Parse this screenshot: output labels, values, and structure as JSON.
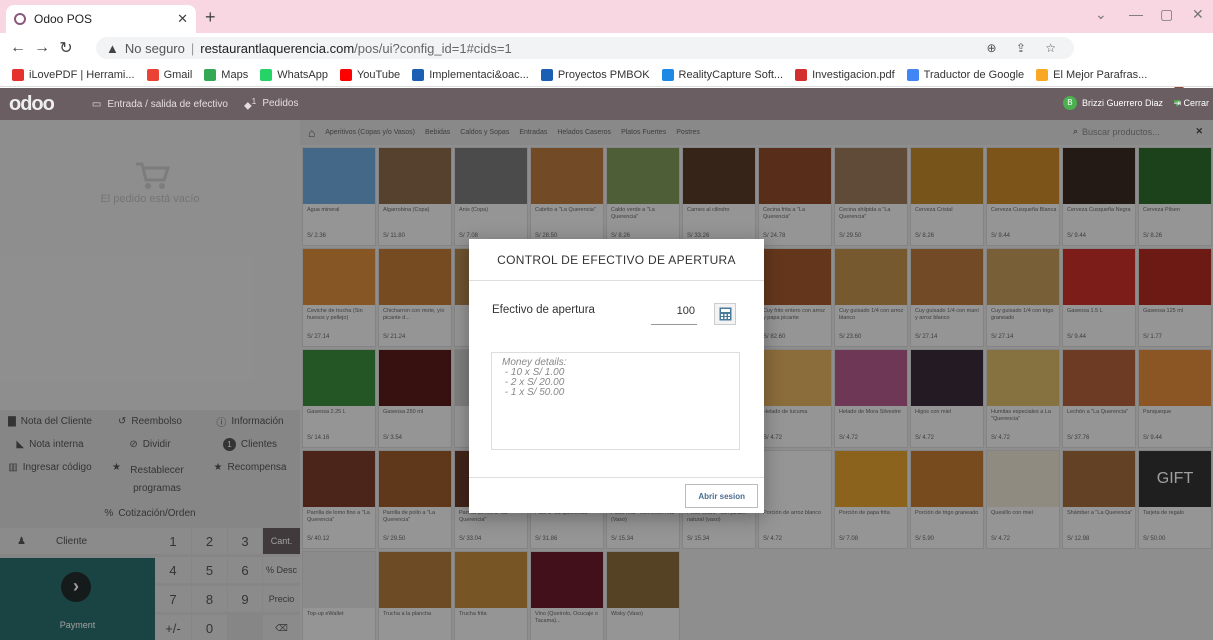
{
  "browser": {
    "tab_title": "Odoo POS",
    "address_warning": "No seguro",
    "url_host": "restaurantlaquerencia.com",
    "url_path": "/pos/ui?config_id=1#cids=1",
    "bookmarks": [
      {
        "label": "iLovePDF | Herrami...",
        "color": "#e5322d"
      },
      {
        "label": "Gmail",
        "color": "#ea4335"
      },
      {
        "label": "Maps",
        "color": "#34a853"
      },
      {
        "label": "WhatsApp",
        "color": "#25d366"
      },
      {
        "label": "YouTube",
        "color": "#ff0000"
      },
      {
        "label": "Implementaci&oac...",
        "color": "#1a5fb4"
      },
      {
        "label": "Proyectos PMBOK",
        "color": "#1a5fb4"
      },
      {
        "label": "RealityCapture Soft...",
        "color": "#1e88e5"
      },
      {
        "label": "Investigacion.pdf",
        "color": "#d32f2f"
      },
      {
        "label": "Traductor de Google",
        "color": "#4285f4"
      },
      {
        "label": "El Mejor Parafras...",
        "color": "#f9a825"
      }
    ]
  },
  "header": {
    "logo": "odoo",
    "cash_in_out": "Entrada / salida de efectivo",
    "orders_badge": "1",
    "orders": "Pedidos",
    "user_initial": "B",
    "user_name": "Brizzi Guerrero Diaz",
    "close": "Cerrar"
  },
  "left": {
    "empty_order": "El pedido está vacío",
    "controls_row1": [
      "Nota del Cliente",
      "Reembolso",
      "Información"
    ],
    "controls_row2": [
      "Nota interna",
      "Dividir",
      "Clientes"
    ],
    "clients_badge": "1",
    "controls_row3": [
      "Ingresar código",
      "Restablecer programas",
      "Recompensa"
    ],
    "quotation": "Cotización/Orden",
    "customer": "Cliente",
    "keys": [
      "1",
      "2",
      "3",
      "Cant.",
      "4",
      "5",
      "6",
      "% Desc",
      "7",
      "8",
      "9",
      "Precio",
      "+/-",
      "0",
      "⌫"
    ],
    "payment": "Payment"
  },
  "categories": {
    "items": [
      "Aperitivos (Copas y/o Vasos)",
      "Bebidas",
      "Caldos y Sopas",
      "Entradas",
      "Helados Caseros",
      "Platos Fuertes",
      "Postres"
    ],
    "search_placeholder": "Buscar productos..."
  },
  "products": [
    {
      "name": "Agua mineral",
      "price": "S/ 2.36",
      "color": "#6fa8dc"
    },
    {
      "name": "Algarrobina (Copa)",
      "price": "S/ 11.80",
      "color": "#8a6a4a"
    },
    {
      "name": "Anis (Copa)",
      "price": "S/ 7.08",
      "color": "#7a7a7a"
    },
    {
      "name": "Cabrito a \"La Querencia\"",
      "price": "S/ 28.50",
      "color": "#b8793e"
    },
    {
      "name": "Caldo verde a \"La Querencia\"",
      "price": "S/ 8.26",
      "color": "#7e9a5a"
    },
    {
      "name": "Carnes al cilindro",
      "price": "S/ 33.26",
      "color": "#5a3a28"
    },
    {
      "name": "Cecina frita a \"La Querencia\"",
      "price": "S/ 24.78",
      "color": "#8e4a2a"
    },
    {
      "name": "Cecina shilpida a \"La Querencia\"",
      "price": "S/ 29.50",
      "color": "#9a7a5a"
    },
    {
      "name": "Cerveza Cristal",
      "price": "S/ 8.26",
      "color": "#c08a2a"
    },
    {
      "name": "Cerveza Cusqueña Blanca",
      "price": "S/ 9.44",
      "color": "#c9882a"
    },
    {
      "name": "Cerveza Cusqueña Negra",
      "price": "S/ 9.44",
      "color": "#3a2a22"
    },
    {
      "name": "Cerveza Pilsen",
      "price": "S/ 8.26",
      "color": "#2e6b2e"
    },
    {
      "name": "Ceviche de trucha (Sin huesos y pellejo)",
      "price": "S/ 27.14",
      "color": "#d98b3a"
    },
    {
      "name": "Chicharron con mote, y/o picante d...",
      "price": "S/ 21.24",
      "color": "#c07a38"
    },
    {
      "name": "",
      "price": "",
      "color": "#b0864e"
    },
    {
      "name": "",
      "price": "",
      "color": "#9c6b3a"
    },
    {
      "name": "",
      "price": "",
      "color": "#a07a4e"
    },
    {
      "name": "",
      "price": "",
      "color": "#8a5a3a"
    },
    {
      "name": "Cuy frito entero con arroz y papa picante",
      "price": "S/ 82.60",
      "color": "#a25a2e"
    },
    {
      "name": "Cuy guisado 1/4 con arroz blanco",
      "price": "S/ 23.60",
      "color": "#c0904e"
    },
    {
      "name": "Cuy guisado 1/4 con maní y arroz blanco",
      "price": "S/ 27.14",
      "color": "#b87a3e"
    },
    {
      "name": "Cuy guisado 1/4 con trigo graneado",
      "price": "S/ 27.14",
      "color": "#c49a5a"
    },
    {
      "name": "Gaseosa 1.5 L",
      "price": "S/ 9.44",
      "color": "#c8302a"
    },
    {
      "name": "Gaseosa 125 ml",
      "price": "S/ 1.77",
      "color": "#b02a22"
    },
    {
      "name": "Gaseosa 2.25 L",
      "price": "S/ 14.16",
      "color": "#3a8a3a"
    },
    {
      "name": "Gaseosa 250 ml",
      "price": "S/ 3.54",
      "color": "#5a1a1a"
    },
    {
      "name": "",
      "price": "",
      "color": "#cccccc"
    },
    {
      "name": "",
      "price": "",
      "color": "#cccccc"
    },
    {
      "name": "",
      "price": "",
      "color": "#cccccc"
    },
    {
      "name": "",
      "price": "",
      "color": "#cccccc"
    },
    {
      "name": "Helado de lucuma",
      "price": "S/ 4.72",
      "color": "#e0b060"
    },
    {
      "name": "Helado de Mora Silvestre",
      "price": "S/ 4.72",
      "color": "#b05a8a"
    },
    {
      "name": "Higos con miel",
      "price": "S/ 4.72",
      "color": "#3a2a3a"
    },
    {
      "name": "Humitas especiales a La \"Querencia\"",
      "price": "S/ 4.72",
      "color": "#d8b86a"
    },
    {
      "name": "Lechón a \"La Querencia\"",
      "price": "S/ 37.76",
      "color": "#b0603a"
    },
    {
      "name": "Panqueque",
      "price": "S/ 9.44",
      "color": "#e08a3a"
    },
    {
      "name": "Parrilla de lomo fino a \"La Querencia\"",
      "price": "S/ 40.12",
      "color": "#7a3a2a"
    },
    {
      "name": "Parrilla de pollo a \"La Querencia\"",
      "price": "S/ 29.50",
      "color": "#9a5a2a"
    },
    {
      "name": "Parrilla de res a \"La Querencia\"",
      "price": "S/ 33.04",
      "color": "#6a3a2a"
    },
    {
      "name": "Pato a \"La Querencia\"",
      "price": "S/ 31.86",
      "color": "#a0602a"
    },
    {
      "name": "Pisco real - con limon real (Vaso)",
      "price": "S/ 15.34",
      "color": "#d8d0b8"
    },
    {
      "name": "Pisco sours - con jarabe natural (vaso)",
      "price": "S/ 15.34",
      "color": "#e8e0c8"
    },
    {
      "name": "Porción de arroz blanco",
      "price": "S/ 4.72",
      "color": "#f0f0f0"
    },
    {
      "name": "Porción de papa frita",
      "price": "S/ 7.08",
      "color": "#e0a030"
    },
    {
      "name": "Porción de trigo graneado",
      "price": "S/ 5.90",
      "color": "#c07a30"
    },
    {
      "name": "Quesillo con miel",
      "price": "S/ 4.72",
      "color": "#e8e0d0"
    },
    {
      "name": "Shámber a \"La Querencia\"",
      "price": "S/ 12.98",
      "color": "#a06a3a"
    },
    {
      "name": "Tarjeta de regalo",
      "price": "S/ 50.00",
      "color": "#333333",
      "label": "GIFT"
    },
    {
      "name": "Top-up eWallet",
      "price": "",
      "color": "#e0e0e0"
    },
    {
      "name": "Trucha a la plancha",
      "price": "",
      "color": "#b07a3a"
    },
    {
      "name": "Trucha frita",
      "price": "",
      "color": "#c08a3a"
    },
    {
      "name": "Vino (Queirolo, Ocucaje o Tacama)...",
      "price": "",
      "color": "#6a1a2a"
    },
    {
      "name": "Wisky (Vaso)",
      "price": "",
      "color": "#8a6a3a"
    }
  ],
  "modal": {
    "title": "CONTROL DE EFECTIVO DE APERTURA",
    "label": "Efectivo de apertura",
    "value": "100",
    "notes": "Money details:\n - 10 x S/ 1.00\n - 2 x S/ 20.00\n - 1 x S/ 50.00",
    "open_button": "Abrir sesion"
  }
}
